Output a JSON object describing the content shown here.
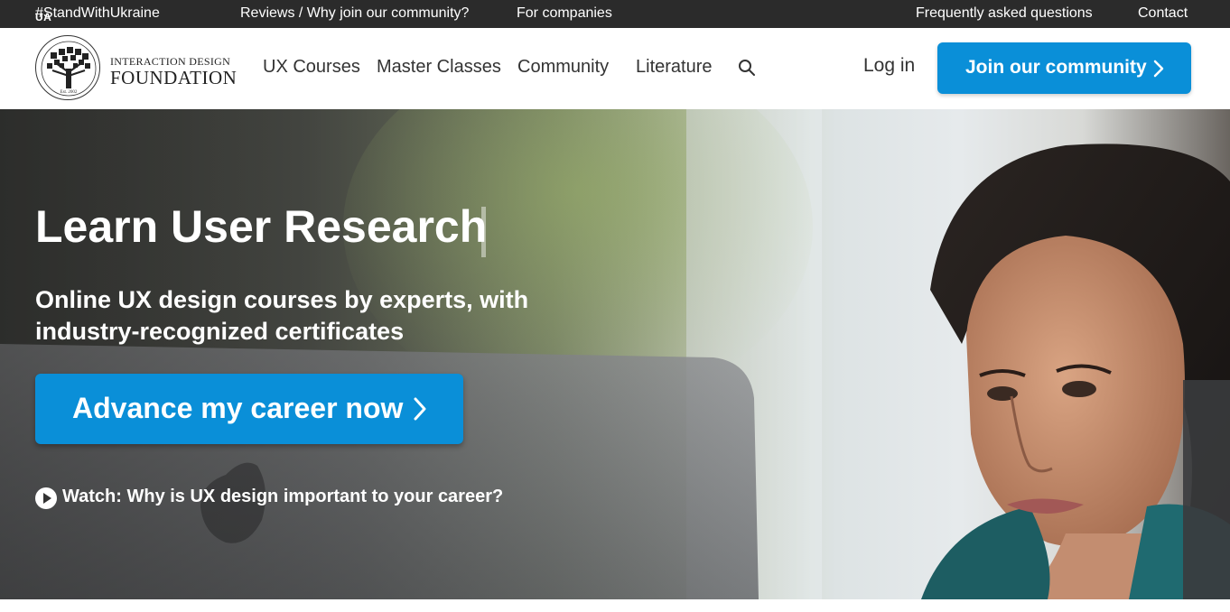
{
  "topbar": {
    "ukraine_code": "UA",
    "ukraine_tag": "#StandWithUkraine",
    "reviews": "Reviews / Why join our community?",
    "companies": "For companies",
    "faq": "Frequently asked questions",
    "contact": "Contact"
  },
  "logo": {
    "line1": "INTERACTION DESIGN",
    "line2": "FOUNDATION",
    "seal_est": "Est. 2002",
    "seal_ring": "INTERACTION DESIGN FOUNDATION"
  },
  "nav": {
    "items": [
      "UX Courses",
      "Master Classes",
      "Community",
      "Literature"
    ],
    "search_icon": "search-icon",
    "login": "Log in",
    "join": "Join our community"
  },
  "hero": {
    "headline": "Learn User Research",
    "subtitle": "Online UX design courses by experts, with industry-recognized certificates",
    "cta": "Advance my career now",
    "watch": "Watch: Why is UX design important to your career?"
  },
  "colors": {
    "accent": "#0a8fd8",
    "topbar": "#2b2b2b",
    "text": "#333333"
  }
}
